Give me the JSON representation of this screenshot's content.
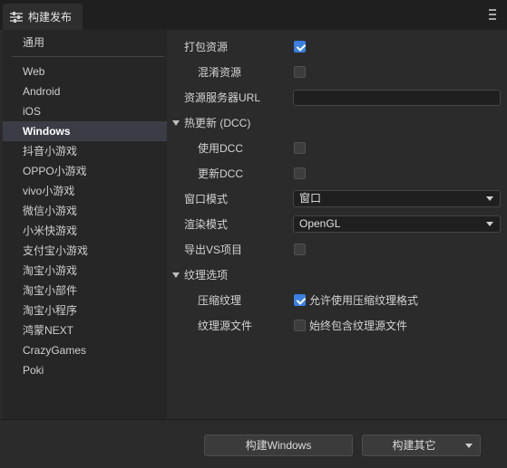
{
  "tab": {
    "title": "构建发布",
    "icon": "sliders-icon"
  },
  "menu": {
    "icon": "menu-icon"
  },
  "sidebar": {
    "items": [
      {
        "label": "通用"
      },
      {
        "label": "Web"
      },
      {
        "label": "Android"
      },
      {
        "label": "iOS"
      },
      {
        "label": "Windows",
        "active": true
      },
      {
        "label": "抖音小游戏"
      },
      {
        "label": "OPPO小游戏"
      },
      {
        "label": "vivo小游戏"
      },
      {
        "label": "微信小游戏"
      },
      {
        "label": "小米快游戏"
      },
      {
        "label": "支付宝小游戏"
      },
      {
        "label": "淘宝小游戏"
      },
      {
        "label": "淘宝小部件"
      },
      {
        "label": "淘宝小程序"
      },
      {
        "label": "鸿蒙NEXT"
      },
      {
        "label": "CrazyGames"
      },
      {
        "label": "Poki"
      }
    ]
  },
  "settings": {
    "pack_assets": {
      "label": "打包资源",
      "checked": true
    },
    "obfuscate_assets": {
      "label": "混淆资源",
      "checked": false
    },
    "asset_server_url": {
      "label": "资源服务器URL",
      "value": "",
      "placeholder": ""
    },
    "hot_update": {
      "label": "热更新 (DCC)",
      "expanded": true
    },
    "use_dcc": {
      "label": "使用DCC",
      "checked": false
    },
    "update_dcc": {
      "label": "更新DCC",
      "checked": false
    },
    "window_mode": {
      "label": "窗口模式",
      "value": "窗口"
    },
    "render_mode": {
      "label": "渲染模式",
      "value": "OpenGL"
    },
    "export_vs": {
      "label": "导出VS项目",
      "checked": false
    },
    "texture_options": {
      "label": "纹理选项",
      "expanded": true
    },
    "compress_texture": {
      "label": "压缩纹理",
      "checked": true,
      "text": "允许使用压缩纹理格式"
    },
    "texture_source": {
      "label": "纹理源文件",
      "checked": false,
      "text": "始终包含纹理源文件"
    }
  },
  "footer": {
    "build_button": "构建Windows",
    "build_other_button": "构建其它"
  },
  "colors": {
    "accent": "#3b7fe0",
    "selected_bg": "#3a3d46",
    "panel_bg": "#2b2b2b",
    "sidebar_bg": "#262626"
  }
}
